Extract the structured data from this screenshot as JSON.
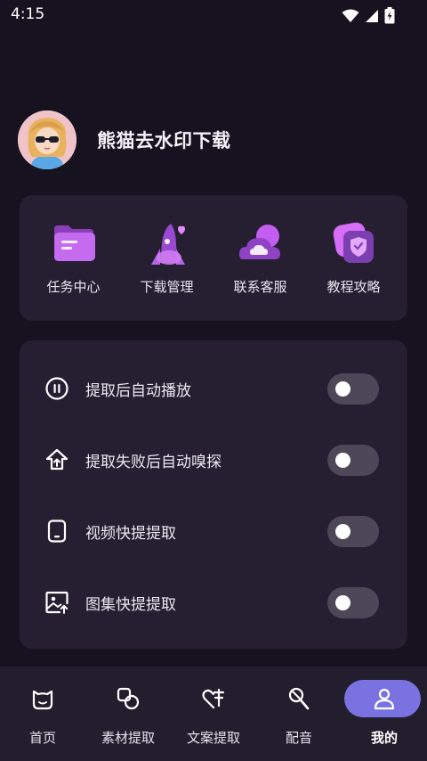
{
  "status_bar": {
    "time": "4:15"
  },
  "profile": {
    "name": "熊猫去水印下载"
  },
  "shortcuts": [
    {
      "label": "任务中心",
      "icon": "folder-icon"
    },
    {
      "label": "下载管理",
      "icon": "rocket-icon"
    },
    {
      "label": "联系客服",
      "icon": "cloud-icon"
    },
    {
      "label": "教程攻略",
      "icon": "shield-icon"
    }
  ],
  "settings": [
    {
      "label": "提取后自动播放",
      "icon": "pause-circle-icon",
      "enabled": false
    },
    {
      "label": "提取失败后自动嗅探",
      "icon": "upload-home-icon",
      "enabled": false
    },
    {
      "label": "视频快提提取",
      "icon": "phone-icon",
      "enabled": false
    },
    {
      "label": "图集快提提取",
      "icon": "image-upload-icon",
      "enabled": false
    }
  ],
  "bottom_nav": {
    "active": "我的",
    "items": [
      {
        "label": "首页",
        "icon": "home-cat-icon"
      },
      {
        "label": "素材提取",
        "icon": "shapes-icon"
      },
      {
        "label": "文案提取",
        "icon": "text-heart-icon"
      },
      {
        "label": "配音",
        "icon": "microphone-icon"
      },
      {
        "label": "我的",
        "icon": "user-icon"
      }
    ]
  },
  "colors": {
    "background": "#16121f",
    "card": "#251f31",
    "accent": "#7a72e0",
    "toggle_off": "#4d4758"
  }
}
